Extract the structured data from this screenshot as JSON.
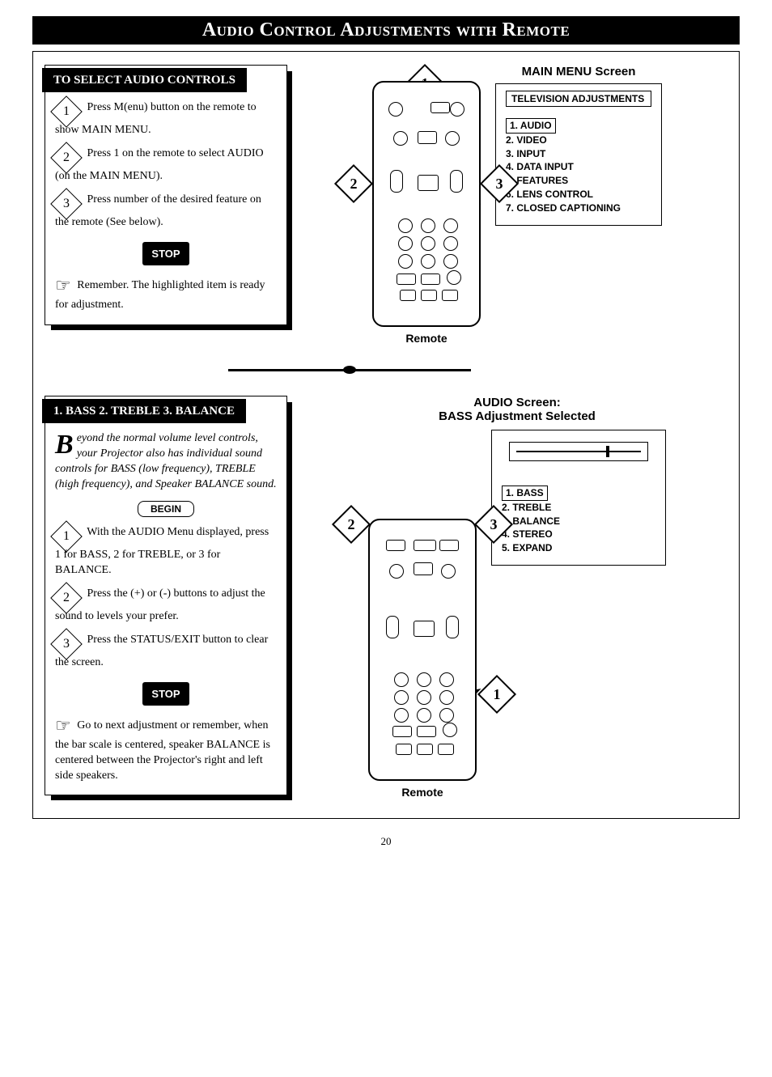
{
  "page": {
    "title": "Audio Control Adjustments with Remote",
    "number": "20"
  },
  "section1": {
    "header": "TO SELECT AUDIO CONTROLS",
    "step1": "Press M(enu) button on the remote to show MAIN MENU.",
    "step2": "Press 1 on the remote to select AUDIO (on the MAIN MENU).",
    "step3": "Press number of the desired feature on the remote (See below).",
    "stop": "STOP",
    "note": "Remember. The highlighted item is ready for adjustment.",
    "remote_label": "Remote",
    "menu_title": "MAIN MENU Screen",
    "menu_header": "TELEVISION ADJUSTMENTS",
    "menu_items": {
      "i1": "1. AUDIO",
      "i2": "2. VIDEO",
      "i3": "3. INPUT",
      "i4": "4. DATA INPUT",
      "i5": "5. FEATURES",
      "i6": "6. LENS CONTROL",
      "i7": "7. CLOSED CAPTIONING"
    }
  },
  "section2": {
    "header": "1. BASS  2. TREBLE  3. BALANCE",
    "intro_lead": "B",
    "intro": "eyond the normal volume level controls, your Projector also has individual sound controls for BASS (low frequency), TREBLE (high frequency), and Speaker BALANCE sound.",
    "begin": "BEGIN",
    "step1": "With the AUDIO Menu displayed, press 1 for BASS, 2 for TREBLE, or 3 for BALANCE.",
    "step2": "Press the (+) or (-) buttons to adjust the sound to levels your prefer.",
    "step3": "Press the STATUS/EXIT button to clear the screen.",
    "stop": "STOP",
    "note": "Go to next adjustment or remember, when the bar scale is centered, speaker BALANCE is centered between the Projector's right and left side speakers.",
    "remote_label": "Remote",
    "menu_title_line1": "AUDIO Screen:",
    "menu_title_line2": "BASS Adjustment Selected",
    "menu_items": {
      "i1": "1. BASS",
      "i2": "2. TREBLE",
      "i3": "3. BALANCE",
      "i4": "4. STEREO",
      "i5": "5. EXPAND"
    }
  }
}
